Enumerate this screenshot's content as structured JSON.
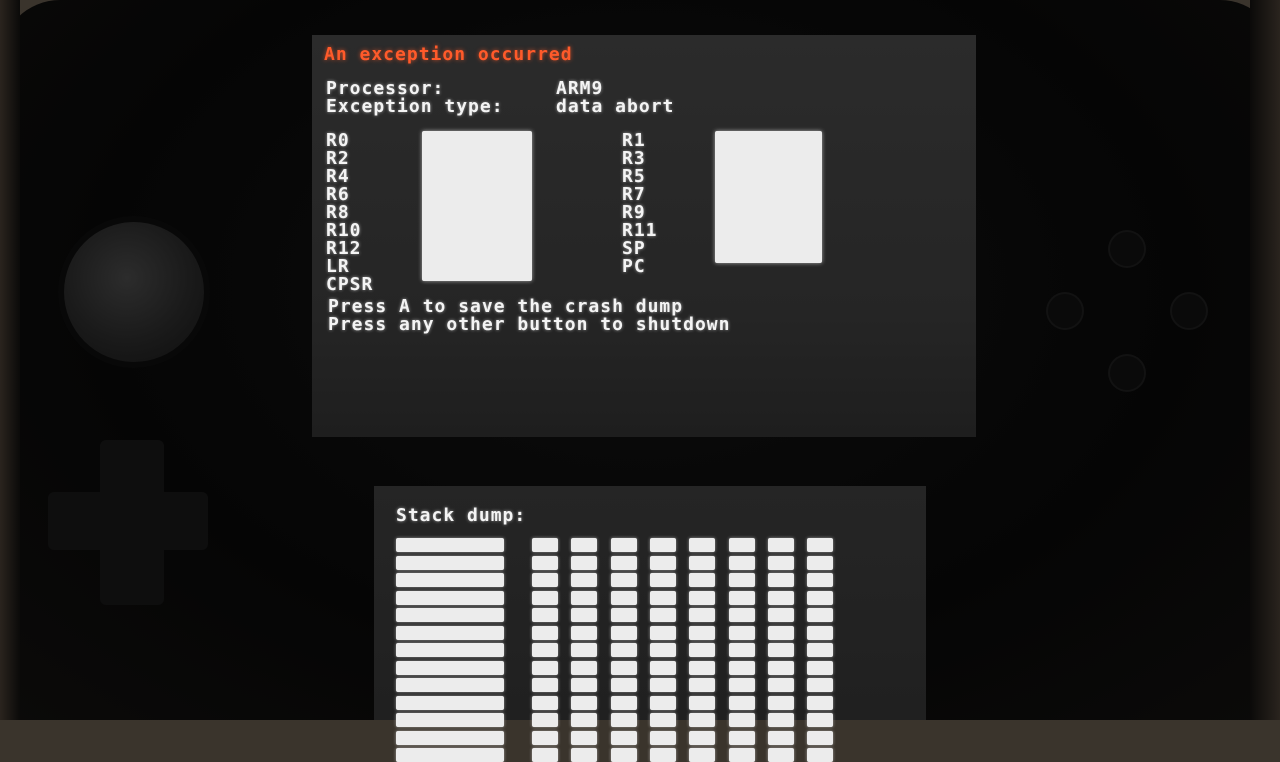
{
  "top_screen": {
    "title": "An exception occurred",
    "processor_label": "Processor:",
    "processor_value": "ARM9",
    "exception_label": "Exception type:",
    "exception_value": "data abort",
    "registers_left": [
      "R0",
      "R2",
      "R4",
      "R6",
      "R8",
      "R10",
      "R12",
      "LR",
      "CPSR"
    ],
    "registers_right": [
      "R1",
      "R3",
      "R5",
      "R7",
      "R9",
      "R11",
      "SP",
      "PC"
    ],
    "prompt_save": "Press A to save the crash dump",
    "prompt_shutdown": "Press any other button to shutdown"
  },
  "bottom_screen": {
    "title": "Stack dump:",
    "row_count": 13,
    "byte_columns": 8
  },
  "colors": {
    "title_red": "#ff5a2a",
    "text_white": "#f4f4f4",
    "screen_bg": "#2b2b2b",
    "device_body": "#050505"
  }
}
